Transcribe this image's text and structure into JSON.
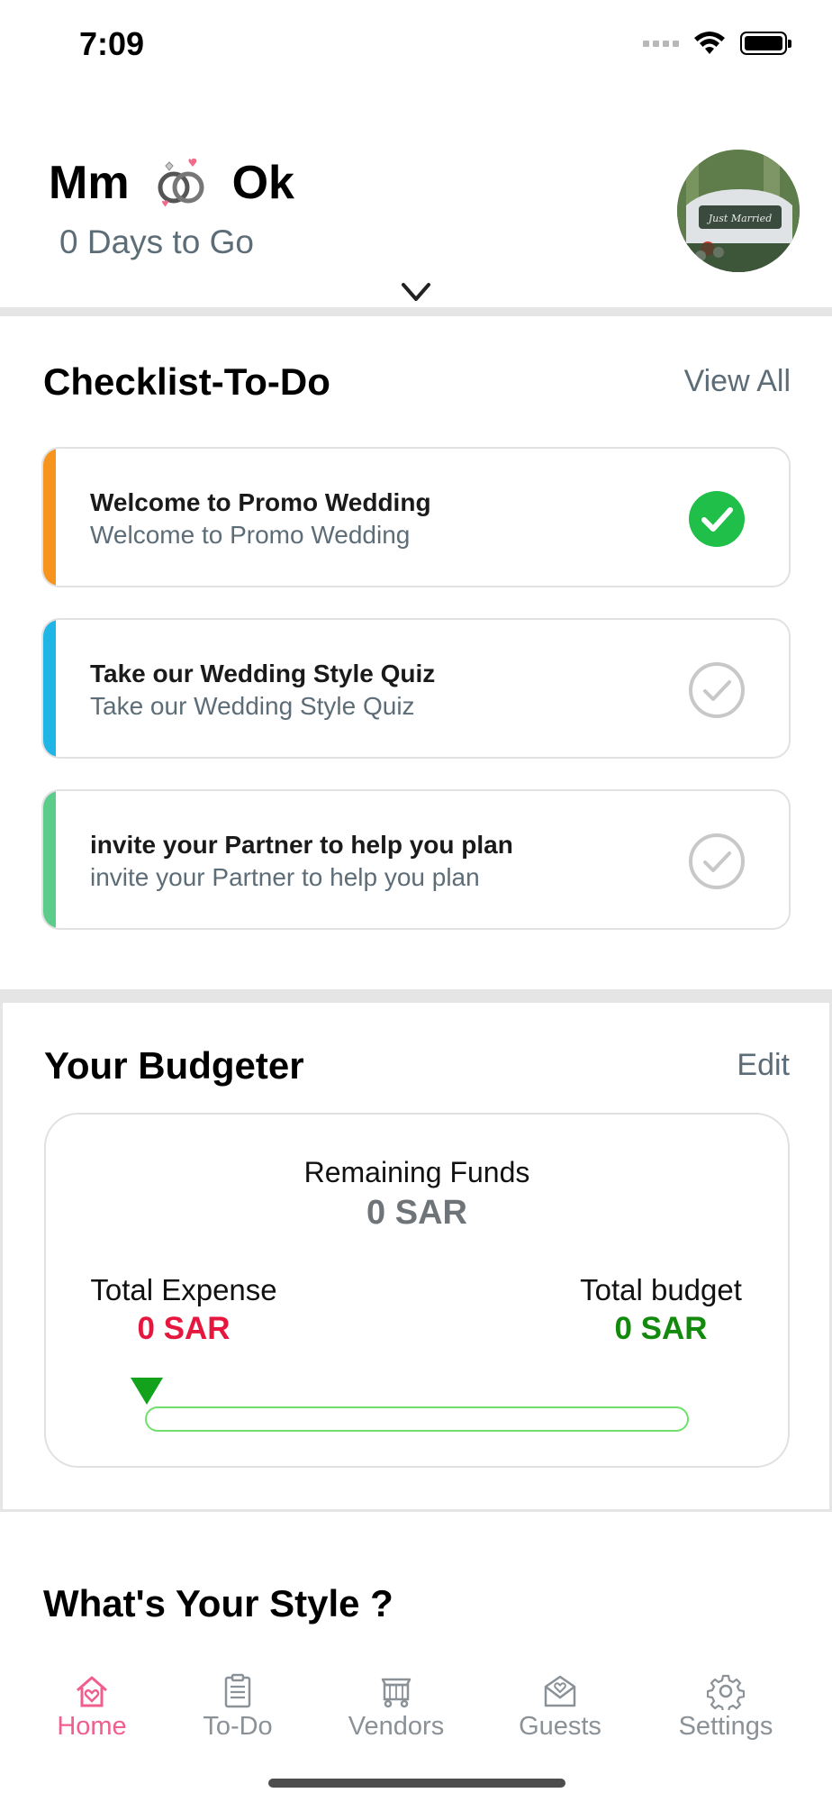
{
  "status": {
    "time": "7:09"
  },
  "header": {
    "name_left": "Mm",
    "name_right": "Ok",
    "countdown": "0 Days to Go",
    "avatar_icon": "wedding-car-photo"
  },
  "checklist": {
    "title": "Checklist-To-Do",
    "view_all": "View All",
    "items": [
      {
        "title": "Welcome to Promo Wedding",
        "subtitle": "Welcome to Promo Wedding",
        "done": true,
        "accent": "#f7941d"
      },
      {
        "title": "Take our Wedding Style Quiz",
        "subtitle": "Take our Wedding Style Quiz",
        "done": false,
        "accent": "#1fb5e5"
      },
      {
        "title": "invite your Partner to help you plan",
        "subtitle": "invite your Partner to help you plan",
        "done": false,
        "accent": "#5bcc8a"
      }
    ]
  },
  "budgeter": {
    "title": "Your Budgeter",
    "edit": "Edit",
    "remaining_label": "Remaining Funds",
    "remaining_value": "0 SAR",
    "expense_label": "Total Expense",
    "expense_value": "0 SAR",
    "budget_label": "Total budget",
    "budget_value": "0 SAR",
    "spent_fraction": 0,
    "colors": {
      "expense": "#e5173f",
      "budget": "#138a0d",
      "progress": "#6fe06c"
    }
  },
  "style_section": {
    "title": "What's Your Style ?"
  },
  "tabs": [
    {
      "label": "Home",
      "icon": "home-heart-icon",
      "active": true
    },
    {
      "label": "To-Do",
      "icon": "clipboard-icon",
      "active": false
    },
    {
      "label": "Vendors",
      "icon": "vendor-cart-icon",
      "active": false
    },
    {
      "label": "Guests",
      "icon": "envelope-heart-icon",
      "active": false
    },
    {
      "label": "Settings",
      "icon": "gear-icon",
      "active": false
    }
  ],
  "accent_color": "#ef5f8d"
}
